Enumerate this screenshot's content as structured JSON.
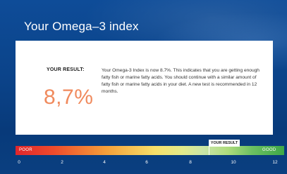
{
  "page": {
    "title": "Your Omega–3 index"
  },
  "result": {
    "label": "YOUR RESULT:",
    "value_display": "8,7%",
    "value": 8.7,
    "description": "Your Omega-3 Index is now 8.7%. This indicates that you are getting enough fatty fish or marine fatty acids. You should continue with a similar amount of fatty fish or marine fatty acids in your diet. A new test is recommended in 12 months."
  },
  "scale": {
    "poor_label": "POOR",
    "good_label": "GOOD",
    "marker_label": "YOUR RESULT",
    "min": 0,
    "max": 12,
    "ticks": [
      "0",
      "2",
      "4",
      "6",
      "8",
      "10",
      "12"
    ],
    "colors": {
      "poor": "#e0262c",
      "mid": "#f7e06a",
      "good": "#3ea848",
      "result_value": "#f08a5d",
      "background": "#0b4389"
    }
  }
}
